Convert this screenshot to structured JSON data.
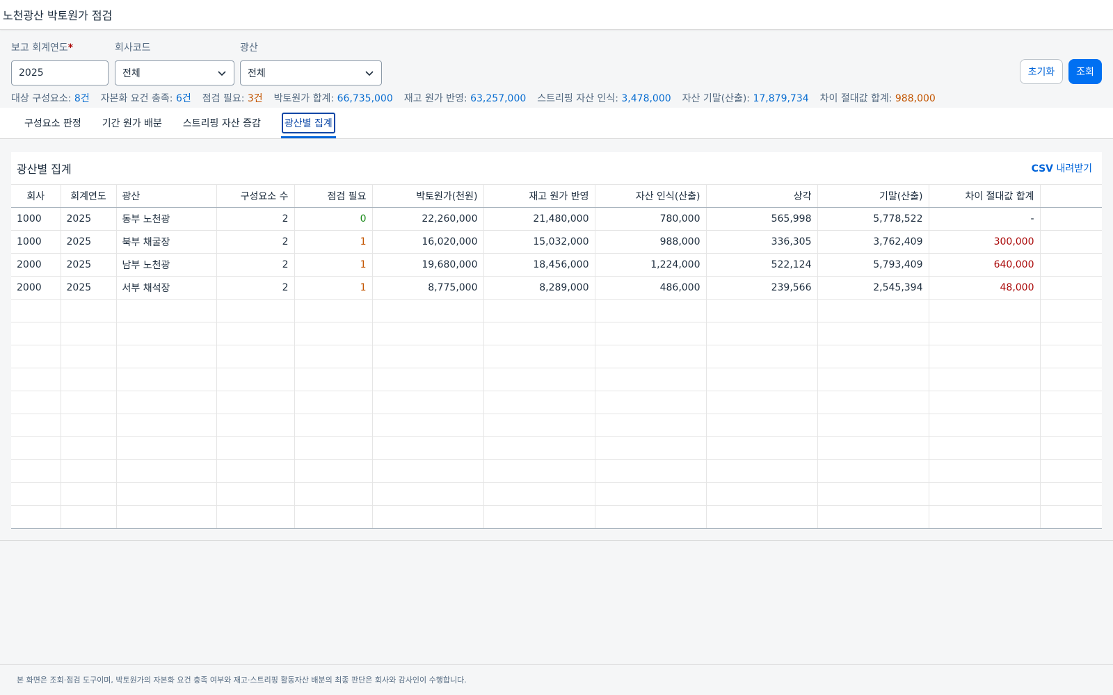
{
  "header": {
    "title": "노천광산 박토원가 점검"
  },
  "filters": {
    "year": {
      "label": "보고 회계연도",
      "required_mark": "*",
      "value": "2025"
    },
    "company": {
      "label": "회사코드",
      "value": "전체"
    },
    "mine": {
      "label": "광산",
      "value": "전체"
    },
    "reset_label": "초기화",
    "search_label": "조회"
  },
  "stats": [
    {
      "label": "대상 구성요소: ",
      "value": "8건",
      "tone": "blue"
    },
    {
      "label": "자본화 요건 충족: ",
      "value": "6건",
      "tone": "blue"
    },
    {
      "label": "점검 필요: ",
      "value": "3건",
      "tone": "orange"
    },
    {
      "label": "박토원가 합계: ",
      "value": "66,735,000",
      "tone": "blue"
    },
    {
      "label": "재고 원가 반영: ",
      "value": "63,257,000",
      "tone": "blue"
    },
    {
      "label": "스트리핑 자산 인식: ",
      "value": "3,478,000",
      "tone": "blue"
    },
    {
      "label": "자산 기말(산출): ",
      "value": "17,879,734",
      "tone": "blue"
    },
    {
      "label": "차이 절대값 합계: ",
      "value": "988,000",
      "tone": "orange"
    }
  ],
  "tabs": [
    {
      "label": "구성요소 판정",
      "active": false
    },
    {
      "label": "기간 원가 배분",
      "active": false
    },
    {
      "label": "스트리핑 자산 증감",
      "active": false
    },
    {
      "label": "광산별 집계",
      "active": true
    }
  ],
  "summary": {
    "title": "광산별 집계",
    "csv_prefix": "CSV",
    "csv_suffix": " 내려받기",
    "columns": [
      "회사",
      "회계연도",
      "광산",
      "구성요소 수",
      "점검 필요",
      "박토원가(천원)",
      "재고 원가 반영",
      "자산 인식(산출)",
      "상각",
      "기말(산출)",
      "차이 절대값 합계"
    ],
    "rows": [
      [
        "1000",
        "2025",
        "동부 노천광",
        "2",
        "0",
        "22,260,000",
        "21,480,000",
        "780,000",
        "565,998",
        "5,778,522",
        "-"
      ],
      [
        "1000",
        "2025",
        "북부 채굴장",
        "2",
        "1",
        "16,020,000",
        "15,032,000",
        "988,000",
        "336,305",
        "3,762,409",
        "300,000"
      ],
      [
        "2000",
        "2025",
        "남부 노천광",
        "2",
        "1",
        "19,680,000",
        "18,456,000",
        "1,224,000",
        "522,124",
        "5,793,409",
        "640,000"
      ],
      [
        "2000",
        "2025",
        "서부 채석장",
        "2",
        "1",
        "8,775,000",
        "8,289,000",
        "486,000",
        "239,566",
        "2,545,394",
        "48,000"
      ]
    ],
    "empty_rows": 10
  },
  "footer": {
    "note": "본 화면은 조회·점검 도구이며, 박토원가의 자본화 요건 충족 여부와 재고·스트리핑 활동자산 배분의 최종 판단은 회사와 감사인이 수행합니다."
  },
  "colors": {
    "accent": "#0070f2",
    "link": "#0064d9",
    "value_blue": "#0a6ed1",
    "warning": "#c35500",
    "error": "#aa0808",
    "ok": "#188918"
  },
  "icons": {
    "select_arrow": "chevron-down-icon"
  }
}
